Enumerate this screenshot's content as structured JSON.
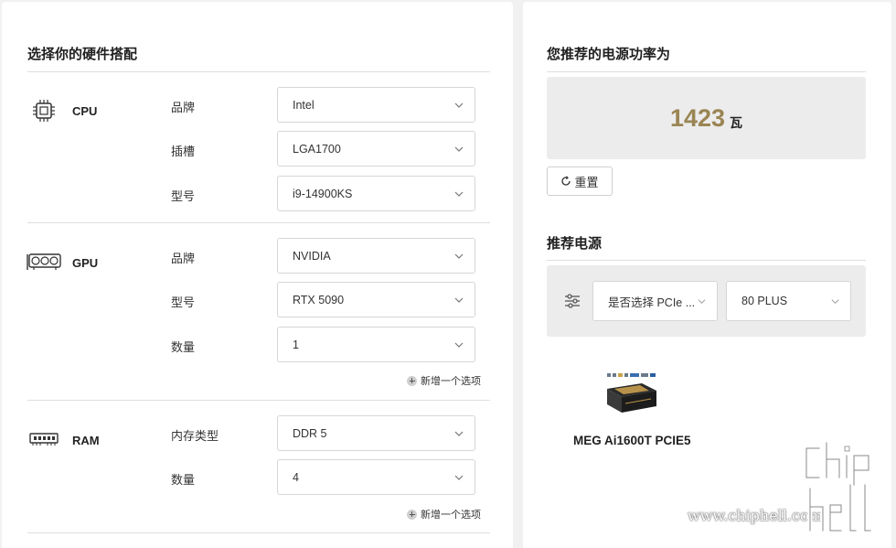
{
  "left": {
    "title": "选择你的硬件搭配",
    "add_option": "新增一个选项",
    "sections": {
      "cpu": {
        "name": "CPU",
        "icon": "cpu-chip-icon",
        "fields": [
          {
            "label": "品牌",
            "value": "Intel"
          },
          {
            "label": "插槽",
            "value": "LGA1700"
          },
          {
            "label": "型号",
            "value": "i9-14900KS"
          }
        ]
      },
      "gpu": {
        "name": "GPU",
        "icon": "graphics-card-icon",
        "fields": [
          {
            "label": "品牌",
            "value": "NVIDIA"
          },
          {
            "label": "型号",
            "value": "RTX 5090"
          },
          {
            "label": "数量",
            "value": "1"
          }
        ]
      },
      "ram": {
        "name": "RAM",
        "icon": "memory-stick-icon",
        "fields": [
          {
            "label": "内存类型",
            "value": "DDR 5"
          },
          {
            "label": "数量",
            "value": "4"
          }
        ]
      }
    }
  },
  "right": {
    "title": "您推荐的电源功率为",
    "wattage": "1423",
    "wattage_unit": "瓦",
    "reset_label": "重置",
    "recommend_title": "推荐电源",
    "filters": {
      "pcie": "是否选择 PCIe ...",
      "plus": "80 PLUS"
    },
    "product": {
      "name": "MEG Ai1600T PCIE5"
    }
  },
  "watermark": {
    "url": "www.chiphell.com",
    "logo_text": "chiphell"
  },
  "colors": {
    "accent_gold": "#9a8553",
    "background": "#f1f1f1",
    "panel": "#ffffff"
  }
}
